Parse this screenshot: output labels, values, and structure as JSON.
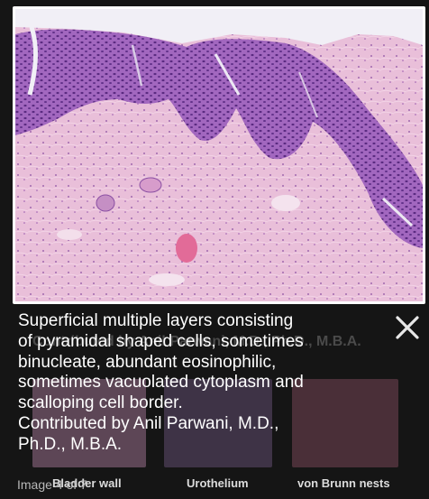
{
  "viewer": {
    "caption_lines": [
      "Superficial multiple layers consisting",
      "of pyramidal shaped cells, sometimes",
      "binucleate, abundant eosinophilic,",
      "sometimes vacuolated cytoplasm and",
      "scalloping cell border."
    ],
    "credit_lines": [
      "Contributed by Anil Parwani, M.D.,",
      "Ph.D., M.B.A."
    ],
    "ghost_credit": "Contributed by Anil Parwani, M.D., Ph.D., M.B.A.",
    "counter": "Image 4 of 7",
    "close_icon": "close-icon"
  },
  "thumbnails": [
    {
      "label": "Bladder wall"
    },
    {
      "label": "Urothelium"
    },
    {
      "label": "von Brunn nests"
    }
  ],
  "colors": {
    "stroma": "#e6b8d6",
    "epithelium": "#9b5bb5",
    "nuclei": "#5a2a80",
    "background": "#151515"
  }
}
